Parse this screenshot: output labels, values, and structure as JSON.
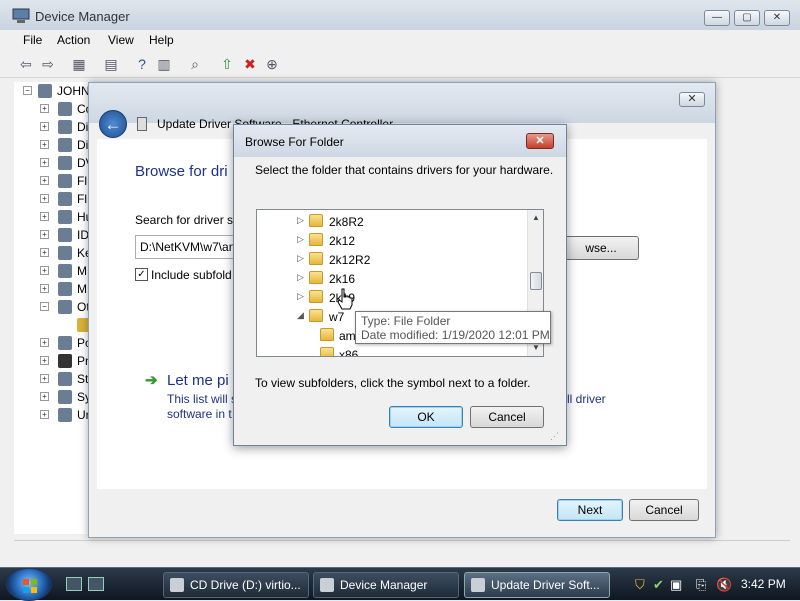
{
  "device_manager": {
    "title": "Device Manager",
    "menu": [
      "File",
      "Action",
      "View",
      "Help"
    ],
    "root_node": "JOHN",
    "tree_items": [
      {
        "label": "Co",
        "icon": "computer-icon"
      },
      {
        "label": "Di",
        "icon": "disk-drive-icon"
      },
      {
        "label": "Di",
        "icon": "display-adapter-icon"
      },
      {
        "label": "DV",
        "icon": "dvd-drive-icon"
      },
      {
        "label": "Fl",
        "icon": "floppy-controller-icon"
      },
      {
        "label": "Fl",
        "icon": "floppy-drive-icon"
      },
      {
        "label": "Hu",
        "icon": "hid-icon"
      },
      {
        "label": "ID",
        "icon": "ide-controller-icon"
      },
      {
        "label": "Ke",
        "icon": "keyboard-icon"
      },
      {
        "label": "M",
        "icon": "mouse-icon"
      },
      {
        "label": "M",
        "icon": "monitor-icon"
      },
      {
        "label": "Ot",
        "icon": "other-devices-icon"
      },
      {
        "label": "",
        "icon": "warning-device-icon"
      },
      {
        "label": "Po",
        "icon": "port-icon"
      },
      {
        "label": "Pr",
        "icon": "processor-icon"
      },
      {
        "label": "St",
        "icon": "storage-controller-icon"
      },
      {
        "label": "Sy",
        "icon": "system-device-icon"
      },
      {
        "label": "Ur",
        "icon": "usb-controller-icon"
      }
    ]
  },
  "wizard": {
    "title": "Update Driver Software - Ethernet Controller",
    "heading": "Browse for dri",
    "search_label": "Search for driver so",
    "path_value": "D:\\NetKVM\\w7\\an",
    "browse_label": "wse...",
    "include_subfolders_label": "Include subfold",
    "include_subfolders_checked": true,
    "let_me_pick": "Let me pi",
    "desc_line1": "This list will s",
    "desc_line2": "software in t",
    "desc_right": "ll driver",
    "next_label": "Next",
    "cancel_label": "Cancel"
  },
  "browse_dialog": {
    "title": "Browse For Folder",
    "instruction": "Select the folder that contains drivers for your hardware.",
    "folders": [
      {
        "label": "2k8R2",
        "expander": "collapsed",
        "level": 1
      },
      {
        "label": "2k12",
        "expander": "collapsed",
        "level": 1
      },
      {
        "label": "2k12R2",
        "expander": "collapsed",
        "level": 1
      },
      {
        "label": "2k16",
        "expander": "collapsed",
        "level": 1
      },
      {
        "label": "2k19",
        "expander": "collapsed",
        "level": 1
      },
      {
        "label": "w7",
        "expander": "expanded",
        "level": 1
      },
      {
        "label": "amd64",
        "expander": "none",
        "level": 2
      },
      {
        "label": "x86",
        "expander": "none",
        "level": 2
      }
    ],
    "hint": "To view subfolders, click the symbol next to a folder.",
    "ok_label": "OK",
    "cancel_label": "Cancel"
  },
  "tooltip": {
    "type_line": "Type: File Folder",
    "date_line": "Date modified: 1/19/2020 12:01 PM"
  },
  "taskbar": {
    "tasks": [
      {
        "label": "CD Drive (D:) virtio...",
        "active": false
      },
      {
        "label": "Device Manager",
        "active": false
      },
      {
        "label": "Update Driver Soft...",
        "active": true
      }
    ],
    "clock": "3:42 PM"
  },
  "colors": {
    "accent_blue": "#1e3287",
    "folder_yellow": "#f0c64f",
    "close_red": "#c4402b"
  }
}
